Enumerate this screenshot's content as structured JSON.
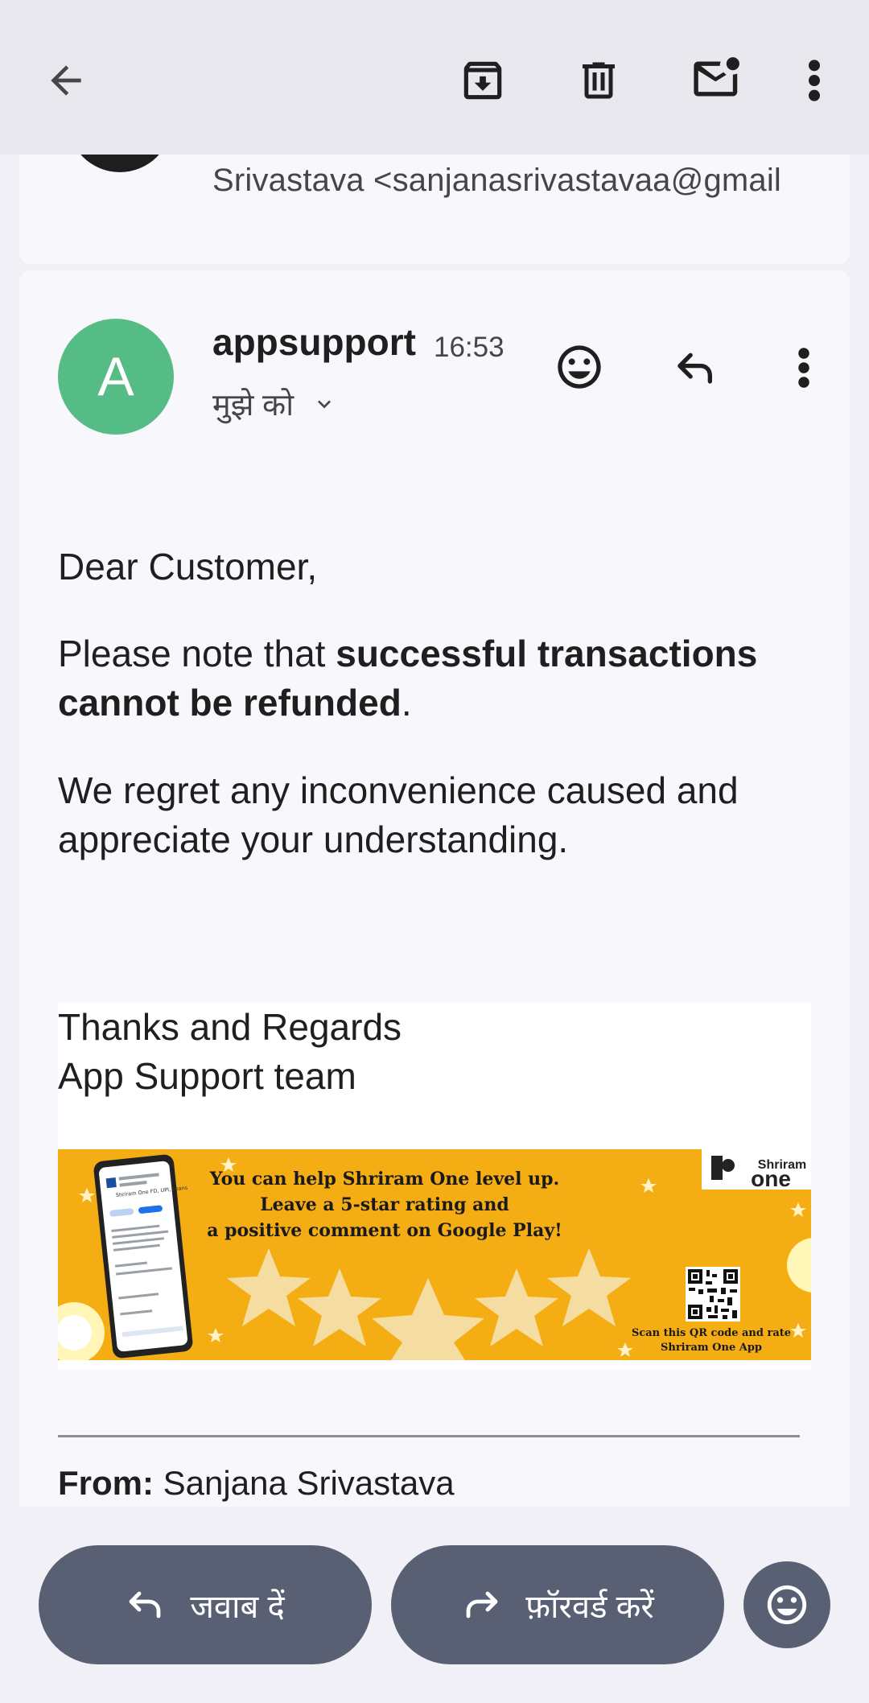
{
  "toolbar": {
    "back_icon": "arrow-back-icon",
    "archive_icon": "archive-icon",
    "delete_icon": "trash-icon",
    "mark_unread_icon": "mark-unread-icon",
    "more_icon": "more-vert-icon"
  },
  "previous_message": {
    "sender_line": "Srivastava <sanjanasrivastavaa@gmail"
  },
  "message": {
    "avatar_letter": "A",
    "avatar_color": "#56bc85",
    "sender": "appsupport",
    "time": "16:53",
    "recipient": "मुझे को",
    "greeting": "Dear Customer,",
    "para1_prefix": "Please note that ",
    "para1_bold": "successful transactions cannot be refunded",
    "para1_suffix": ".",
    "para2": "We regret any inconvenience caused and appreciate your understanding.",
    "signature_line1": "Thanks and Regards",
    "signature_line2": "App Support team",
    "banner": {
      "brand_top": "Shriram",
      "brand_bottom": "one",
      "line1": "You can help Shriram One level up.",
      "line2": "Leave a 5-star rating and",
      "line3": "a positive comment on Google Play!",
      "qr_caption1": "Scan this QR code and rate",
      "qr_caption2": "Shriram One App",
      "phone_title": "Shriram One FD, UPI, Loans",
      "bg_color": "#f5ad14"
    },
    "from_label": "From:",
    "from_value": " Sanjana Srivastava"
  },
  "actions": {
    "reply_label": "जवाब दें",
    "forward_label": "फ़ॉरवर्ड करें",
    "pill_color": "#596074"
  }
}
